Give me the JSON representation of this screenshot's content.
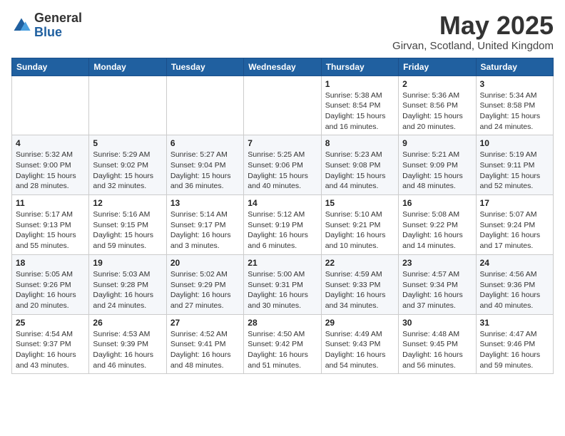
{
  "header": {
    "logo_general": "General",
    "logo_blue": "Blue",
    "month": "May 2025",
    "location": "Girvan, Scotland, United Kingdom"
  },
  "weekdays": [
    "Sunday",
    "Monday",
    "Tuesday",
    "Wednesday",
    "Thursday",
    "Friday",
    "Saturday"
  ],
  "weeks": [
    [
      {
        "day": "",
        "info": ""
      },
      {
        "day": "",
        "info": ""
      },
      {
        "day": "",
        "info": ""
      },
      {
        "day": "",
        "info": ""
      },
      {
        "day": "1",
        "info": "Sunrise: 5:38 AM\nSunset: 8:54 PM\nDaylight: 15 hours\nand 16 minutes."
      },
      {
        "day": "2",
        "info": "Sunrise: 5:36 AM\nSunset: 8:56 PM\nDaylight: 15 hours\nand 20 minutes."
      },
      {
        "day": "3",
        "info": "Sunrise: 5:34 AM\nSunset: 8:58 PM\nDaylight: 15 hours\nand 24 minutes."
      }
    ],
    [
      {
        "day": "4",
        "info": "Sunrise: 5:32 AM\nSunset: 9:00 PM\nDaylight: 15 hours\nand 28 minutes."
      },
      {
        "day": "5",
        "info": "Sunrise: 5:29 AM\nSunset: 9:02 PM\nDaylight: 15 hours\nand 32 minutes."
      },
      {
        "day": "6",
        "info": "Sunrise: 5:27 AM\nSunset: 9:04 PM\nDaylight: 15 hours\nand 36 minutes."
      },
      {
        "day": "7",
        "info": "Sunrise: 5:25 AM\nSunset: 9:06 PM\nDaylight: 15 hours\nand 40 minutes."
      },
      {
        "day": "8",
        "info": "Sunrise: 5:23 AM\nSunset: 9:08 PM\nDaylight: 15 hours\nand 44 minutes."
      },
      {
        "day": "9",
        "info": "Sunrise: 5:21 AM\nSunset: 9:09 PM\nDaylight: 15 hours\nand 48 minutes."
      },
      {
        "day": "10",
        "info": "Sunrise: 5:19 AM\nSunset: 9:11 PM\nDaylight: 15 hours\nand 52 minutes."
      }
    ],
    [
      {
        "day": "11",
        "info": "Sunrise: 5:17 AM\nSunset: 9:13 PM\nDaylight: 15 hours\nand 55 minutes."
      },
      {
        "day": "12",
        "info": "Sunrise: 5:16 AM\nSunset: 9:15 PM\nDaylight: 15 hours\nand 59 minutes."
      },
      {
        "day": "13",
        "info": "Sunrise: 5:14 AM\nSunset: 9:17 PM\nDaylight: 16 hours\nand 3 minutes."
      },
      {
        "day": "14",
        "info": "Sunrise: 5:12 AM\nSunset: 9:19 PM\nDaylight: 16 hours\nand 6 minutes."
      },
      {
        "day": "15",
        "info": "Sunrise: 5:10 AM\nSunset: 9:21 PM\nDaylight: 16 hours\nand 10 minutes."
      },
      {
        "day": "16",
        "info": "Sunrise: 5:08 AM\nSunset: 9:22 PM\nDaylight: 16 hours\nand 14 minutes."
      },
      {
        "day": "17",
        "info": "Sunrise: 5:07 AM\nSunset: 9:24 PM\nDaylight: 16 hours\nand 17 minutes."
      }
    ],
    [
      {
        "day": "18",
        "info": "Sunrise: 5:05 AM\nSunset: 9:26 PM\nDaylight: 16 hours\nand 20 minutes."
      },
      {
        "day": "19",
        "info": "Sunrise: 5:03 AM\nSunset: 9:28 PM\nDaylight: 16 hours\nand 24 minutes."
      },
      {
        "day": "20",
        "info": "Sunrise: 5:02 AM\nSunset: 9:29 PM\nDaylight: 16 hours\nand 27 minutes."
      },
      {
        "day": "21",
        "info": "Sunrise: 5:00 AM\nSunset: 9:31 PM\nDaylight: 16 hours\nand 30 minutes."
      },
      {
        "day": "22",
        "info": "Sunrise: 4:59 AM\nSunset: 9:33 PM\nDaylight: 16 hours\nand 34 minutes."
      },
      {
        "day": "23",
        "info": "Sunrise: 4:57 AM\nSunset: 9:34 PM\nDaylight: 16 hours\nand 37 minutes."
      },
      {
        "day": "24",
        "info": "Sunrise: 4:56 AM\nSunset: 9:36 PM\nDaylight: 16 hours\nand 40 minutes."
      }
    ],
    [
      {
        "day": "25",
        "info": "Sunrise: 4:54 AM\nSunset: 9:37 PM\nDaylight: 16 hours\nand 43 minutes."
      },
      {
        "day": "26",
        "info": "Sunrise: 4:53 AM\nSunset: 9:39 PM\nDaylight: 16 hours\nand 46 minutes."
      },
      {
        "day": "27",
        "info": "Sunrise: 4:52 AM\nSunset: 9:41 PM\nDaylight: 16 hours\nand 48 minutes."
      },
      {
        "day": "28",
        "info": "Sunrise: 4:50 AM\nSunset: 9:42 PM\nDaylight: 16 hours\nand 51 minutes."
      },
      {
        "day": "29",
        "info": "Sunrise: 4:49 AM\nSunset: 9:43 PM\nDaylight: 16 hours\nand 54 minutes."
      },
      {
        "day": "30",
        "info": "Sunrise: 4:48 AM\nSunset: 9:45 PM\nDaylight: 16 hours\nand 56 minutes."
      },
      {
        "day": "31",
        "info": "Sunrise: 4:47 AM\nSunset: 9:46 PM\nDaylight: 16 hours\nand 59 minutes."
      }
    ]
  ]
}
